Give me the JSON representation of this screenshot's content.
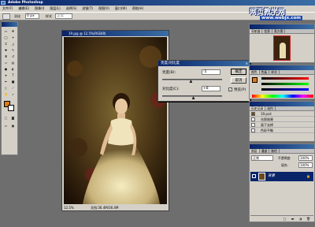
{
  "app": {
    "title": "Adobe Photoshop"
  },
  "menu": [
    "文件(F)",
    "编辑(E)",
    "图像(I)",
    "图层(L)",
    "选择(S)",
    "滤镜(T)",
    "视图(V)",
    "窗口(W)",
    "帮助(H)"
  ],
  "options": {
    "label": "羽化",
    "value": "0 px",
    "mode_label": "样式",
    "mode_value": "正常"
  },
  "watermark": {
    "line1": "网页教学网",
    "line2": "www.webjx.com"
  },
  "document": {
    "title": "19.jpg @ 12.5%(RGB/8)",
    "zoom": "12.5%",
    "doc_size": "文档:36.4M/36.4M"
  },
  "dialog": {
    "title": "亮度/对比度",
    "brightness_label": "亮度(B):",
    "brightness_value": "-5",
    "contrast_label": "对比度(C):",
    "contrast_value": "+8",
    "ok": "确定",
    "cancel": "取消",
    "preview_label": "预览(P)",
    "preview_checked": true,
    "brightness_level": 0.48,
    "contrast_level": 0.52
  },
  "navigator": {
    "tabs": [
      "导航器",
      "信息",
      "直方图"
    ]
  },
  "color_panel": {
    "tabs": [
      "颜色",
      "色板",
      "样式"
    ]
  },
  "history": {
    "tabs": [
      "历史记录",
      "动作"
    ],
    "snapshot": "19.psd",
    "items": [
      "光照效果",
      "画下去掉",
      "色彩平衡"
    ]
  },
  "layers": {
    "tabs": [
      "图层",
      "通道",
      "路径"
    ],
    "blend_mode": "正常",
    "opacity_label": "不透明度:",
    "opacity": "100%",
    "fill_label": "填充:",
    "fill": "100%",
    "layer_name": "背景"
  },
  "colors": {
    "foreground": "#e07a10",
    "background": "#ffffff"
  }
}
